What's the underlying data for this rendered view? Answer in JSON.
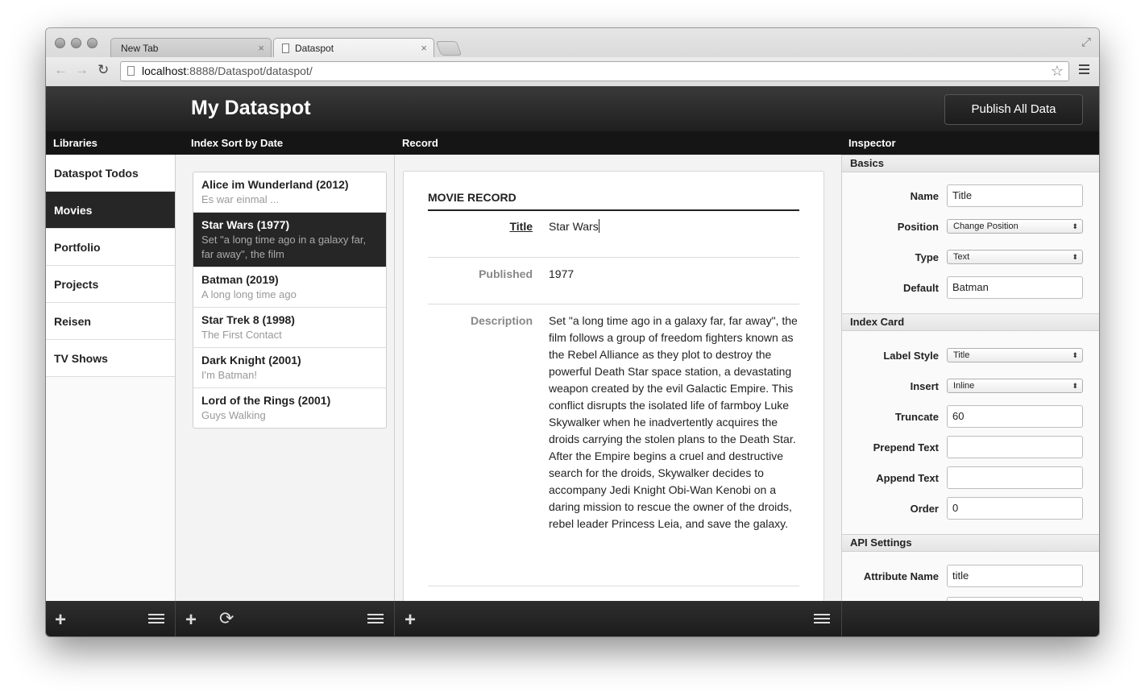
{
  "browser": {
    "tabs": [
      {
        "label": "New Tab",
        "close": "×"
      },
      {
        "label": "Dataspot",
        "close": "×"
      }
    ],
    "url_host": "localhost",
    "url_rest": ":8888/Dataspot/dataspot/",
    "star": "☆"
  },
  "app": {
    "title": "My Dataspot",
    "publish_label": "Publish All Data"
  },
  "columns": {
    "libraries": "Libraries",
    "index": "Index Sort by Date",
    "record": "Record",
    "inspector": "Inspector"
  },
  "libraries": [
    {
      "label": "Dataspot Todos"
    },
    {
      "label": "Movies",
      "selected": true
    },
    {
      "label": "Portfolio"
    },
    {
      "label": "Projects"
    },
    {
      "label": "Reisen"
    },
    {
      "label": "TV Shows"
    }
  ],
  "index_items": [
    {
      "title": "Alice im Wunderland (2012)",
      "sub": "Es war einmal ..."
    },
    {
      "title": "Star Wars (1977)",
      "sub": "Set \"a long time ago in a galaxy far, far away\", the film",
      "selected": true
    },
    {
      "title": "Batman (2019)",
      "sub": "A long long time ago"
    },
    {
      "title": "Star Trek 8 (1998)",
      "sub": "The First Contact"
    },
    {
      "title": "Dark Knight (2001)",
      "sub": "I'm Batman!"
    },
    {
      "title": "Lord of the Rings (2001)",
      "sub": "Guys Walking"
    }
  ],
  "record": {
    "heading": "MOVIE RECORD",
    "fields": [
      {
        "label": "Title",
        "value": "Star Wars"
      },
      {
        "label": "Published",
        "value": "1977"
      },
      {
        "label": "Description",
        "value": "Set \"a long time ago in a galaxy far, far away\", the film follows a group of freedom fighters known as the Rebel Alliance as they plot to destroy the powerful Death Star space station, a devastating weapon created by the evil Galactic Empire. This conflict disrupts the isolated life of farmboy Luke Skywalker when he inadvertently acquires the droids carrying the stolen plans to the Death Star. After the Empire begins a cruel and destructive search for the droids, Skywalker decides to accompany Jedi Knight Obi-Wan Kenobi on a daring mission to rescue the owner of the droids, rebel leader Princess Leia, and save the galaxy."
      }
    ]
  },
  "inspector": {
    "basics": {
      "heading": "Basics",
      "name_label": "Name",
      "name_value": "Title",
      "position_label": "Position",
      "position_value": "Change Position",
      "type_label": "Type",
      "type_value": "Text",
      "default_label": "Default",
      "default_value": "Batman"
    },
    "index_card": {
      "heading": "Index Card",
      "label_style_label": "Label Style",
      "label_style_value": "Title",
      "insert_label": "Insert",
      "insert_value": "Inline",
      "truncate_label": "Truncate",
      "truncate_value": "60",
      "prepend_label": "Prepend Text",
      "prepend_value": "",
      "append_label": "Append Text",
      "append_value": "",
      "order_label": "Order",
      "order_value": "0"
    },
    "api": {
      "heading": "API Settings",
      "attr_label": "Attribute Name",
      "attr_value": "title"
    }
  },
  "icons": {
    "plus": "+",
    "refresh": "⟳",
    "select_arrow": "⬍"
  }
}
